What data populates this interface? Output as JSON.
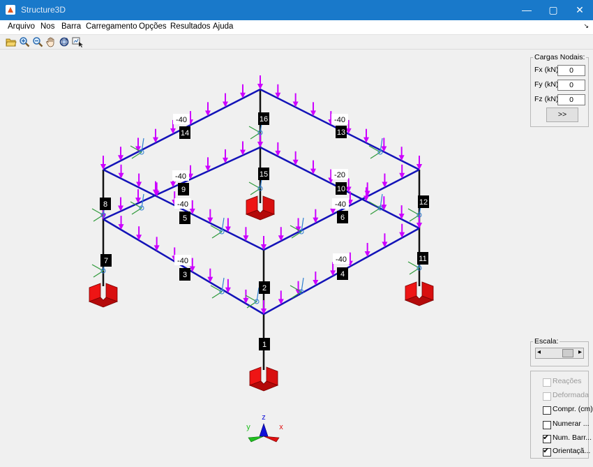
{
  "window": {
    "title": "Structure3D",
    "min_glyph": "—",
    "max_glyph": "▢",
    "close_glyph": "✕"
  },
  "menu": {
    "items": [
      "Arquivo",
      "Nos",
      "Barra",
      "Carregamento",
      "Opções",
      "Resultados",
      "Ajuda"
    ],
    "arrow": "↘"
  },
  "toolbar": {
    "tools": [
      "open-folder-icon",
      "zoom-in-icon",
      "zoom-out-icon",
      "pan-hand-icon",
      "rotate-3d-icon",
      "data-cursor-icon"
    ]
  },
  "cargas": {
    "title": "Cargas Nodais:",
    "fx_label": "Fx (kN):",
    "fx_value": "0",
    "fy_label": "Fy (kN):",
    "fy_value": "0",
    "fz_label": "Fz (kN):",
    "fz_value": "0",
    "apply_label": ">>"
  },
  "escala": {
    "title": "Escala:",
    "left_arrow": "◂",
    "right_arrow": "▸"
  },
  "options": [
    {
      "label": "Reações",
      "checked": false,
      "enabled": false
    },
    {
      "label": "Deformada",
      "checked": false,
      "enabled": false
    },
    {
      "label": "Compr. (cm)",
      "checked": false,
      "enabled": true
    },
    {
      "label": "Numerar ...",
      "checked": false,
      "enabled": true
    },
    {
      "label": "Num. Barr...",
      "checked": true,
      "enabled": true
    },
    {
      "label": "Orientaçã...",
      "checked": true,
      "enabled": true
    }
  ],
  "check_glyph": "✔",
  "model": {
    "colors": {
      "beam": "#1313b8",
      "column": "#111111",
      "load": "#cc00ff",
      "support": "#e01010",
      "local_axis_green": "#2f9a3a",
      "local_axis_blue": "#2f7fd0"
    },
    "bar_labels": [
      "1",
      "2",
      "3",
      "4",
      "5",
      "6",
      "7",
      "8",
      "9",
      "10",
      "11",
      "12",
      "13",
      "14",
      "15",
      "16"
    ],
    "load_values": [
      "-40",
      "-40",
      "-40",
      "-20",
      "-40",
      "-40",
      "-40",
      "-40",
      "-40"
    ]
  },
  "axes": {
    "z": "z",
    "y": "y",
    "x": "x"
  }
}
